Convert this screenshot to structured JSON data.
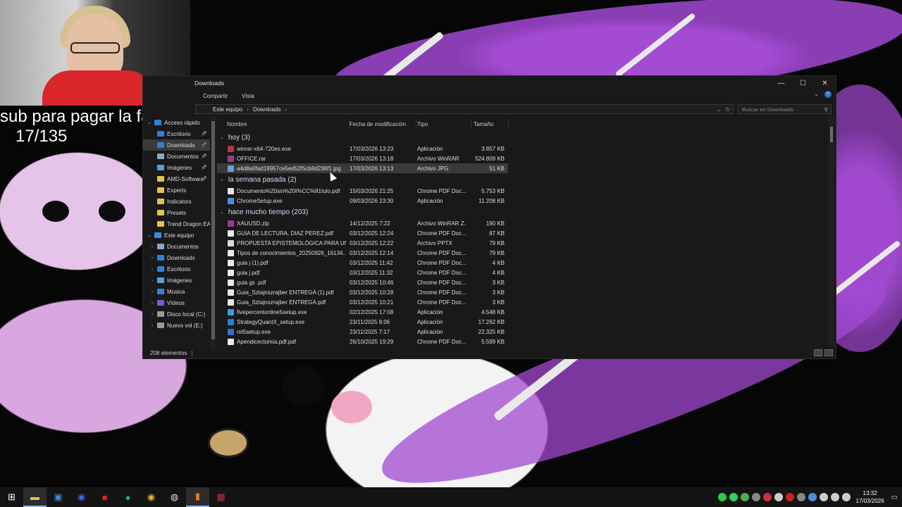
{
  "overlay": {
    "line1": "sub para pagar la facultad",
    "line2": "17/135"
  },
  "window": {
    "title": "Downloads",
    "controls": {
      "minimize": "—",
      "maximize": "☐",
      "close": "✕"
    },
    "ribbon": {
      "share": "Compartir",
      "view": "Vista"
    },
    "address": {
      "root": "Este equipo",
      "current": "Downloads",
      "sep": "›"
    },
    "search_placeholder": "Buscar en Downloads",
    "status": "208 elementos"
  },
  "nav": {
    "quick_access": "Acceso rápido",
    "quick_items": [
      {
        "label": "Escritorio",
        "color": "#2f7fd6"
      },
      {
        "label": "Downloads",
        "color": "#2f7fd6"
      },
      {
        "label": "Documentos",
        "color": "#8aa6c8"
      },
      {
        "label": "Imágenes",
        "color": "#5aa0d8"
      },
      {
        "label": "AMD-Software",
        "color": "#e6c24a"
      },
      {
        "label": "Experts",
        "color": "#e6c24a"
      },
      {
        "label": "Indicators",
        "color": "#e6c24a"
      },
      {
        "label": "Presets",
        "color": "#e6c24a"
      },
      {
        "label": "Trend Dragon EA",
        "color": "#e6c24a"
      }
    ],
    "this_pc": "Este equipo",
    "pc_items": [
      {
        "label": "Documentos",
        "color": "#8aa6c8"
      },
      {
        "label": "Downloads",
        "color": "#2f7fd6"
      },
      {
        "label": "Escritorio",
        "color": "#2f7fd6"
      },
      {
        "label": "Imágenes",
        "color": "#5aa0d8"
      },
      {
        "label": "Música",
        "color": "#3b7fe0"
      },
      {
        "label": "Vídeos",
        "color": "#7a5ad0"
      },
      {
        "label": "Disco local (C:)",
        "color": "#9a9a9a"
      },
      {
        "label": "Nuevo vol (E:)",
        "color": "#9a9a9a"
      }
    ]
  },
  "columns": {
    "name": "Nombre",
    "date": "Fecha de modificación",
    "type": "Tipo",
    "size": "Tamaño"
  },
  "groups": [
    {
      "label": "hoy (3)",
      "rows": [
        {
          "name": "winrar-x64-720es.exe",
          "date": "17/03/2026 13:23",
          "type": "Aplicación",
          "size": "3.857 KB",
          "color": "#b8324a"
        },
        {
          "name": "OFFICE.rar",
          "date": "17/03/2026 13:18",
          "type": "Archivo WinRAR",
          "size": "524.809 KB",
          "color": "#9b3a8e"
        },
        {
          "name": "a4d8a0fad19957ce5ed52f5cb8d236f1.jpg",
          "date": "17/03/2026 13:13",
          "type": "Archivo JPG",
          "size": "51 KB",
          "color": "#6aa0d8",
          "selected": true
        }
      ]
    },
    {
      "label": "la semana pasada (2)",
      "rows": [
        {
          "name": "Documento%20sin%20t%CC%81tulo.pdf",
          "date": "15/03/2026 21:25",
          "type": "Chrome PDF Doc...",
          "size": "5.753 KB",
          "color": "#e8e8e8"
        },
        {
          "name": "ChromeSetup.exe",
          "date": "09/03/2026 23:30",
          "type": "Aplicación",
          "size": "11.208 KB",
          "color": "#4a90e2"
        }
      ]
    },
    {
      "label": "hace mucho tiempo (203)",
      "rows": [
        {
          "name": "XAUUSD.zip",
          "date": "14/12/2025 7:22",
          "type": "Archivo WinRAR Z...",
          "size": "190 KB",
          "color": "#9b3a8e"
        },
        {
          "name": "GUIA DE LECTURA, DIAZ PEREZ.pdf",
          "date": "03/12/2025 12:24",
          "type": "Chrome PDF Doc...",
          "size": "87 KB",
          "color": "#e8e8e8"
        },
        {
          "name": "PROPUESTA EPISTEMOLÓGICA PARA UN...",
          "date": "03/12/2025 12:22",
          "type": "Archivo PPTX",
          "size": "79 KB",
          "color": "#d9d9d9"
        },
        {
          "name": "Tipos de conocimientos_20250926_16134...",
          "date": "03/12/2025 12:14",
          "type": "Chrome PDF Doc...",
          "size": "79 KB",
          "color": "#e8e8e8"
        },
        {
          "name": "guia j (1).pdf",
          "date": "03/12/2025 11:42",
          "type": "Chrome PDF Doc...",
          "size": "4 KB",
          "color": "#e8e8e8"
        },
        {
          "name": "guia j.pdf",
          "date": "03/12/2025 11:32",
          "type": "Chrome PDF Doc...",
          "size": "4 KB",
          "color": "#e8e8e8"
        },
        {
          "name": "guia gs .pdf",
          "date": "03/12/2025 10:46",
          "type": "Chrome PDF Doc...",
          "size": "3 KB",
          "color": "#e8e8e8"
        },
        {
          "name": "Guia_Sztajnszrajber ENTREGA (1).pdf",
          "date": "03/12/2025 10:28",
          "type": "Chrome PDF Doc...",
          "size": "3 KB",
          "color": "#e8e8e8"
        },
        {
          "name": "Guia_Sztajnszrajber ENTREGA.pdf",
          "date": "03/12/2025 10:21",
          "type": "Chrome PDF Doc...",
          "size": "3 KB",
          "color": "#e8e8e8"
        },
        {
          "name": "fivepercentonline5setup.exe",
          "date": "02/12/2025 17:08",
          "type": "Aplicación",
          "size": "4.548 KB",
          "color": "#3aa0d8"
        },
        {
          "name": "StrategyQuantX_setup.exe",
          "date": "23/11/2025 9:06",
          "type": "Aplicación",
          "size": "17.262 KB",
          "color": "#2a7fd4"
        },
        {
          "name": "mt5setup.exe",
          "date": "23/11/2025 7:17",
          "type": "Aplicación",
          "size": "22.325 KB",
          "color": "#3a6fc0"
        },
        {
          "name": "Apendicectomía.pdf.pdf",
          "date": "26/10/2025 19:29",
          "type": "Chrome PDF Doc...",
          "size": "5.599 KB",
          "color": "#e8e8e8"
        }
      ]
    }
  ],
  "taskbar": {
    "icons": [
      {
        "name": "windows-start-icon",
        "glyph": "⊞",
        "color": "#ffffff"
      },
      {
        "name": "file-explorer-icon",
        "glyph": "▬",
        "color": "#e6c24a",
        "active": true
      },
      {
        "name": "store-icon",
        "glyph": "▣",
        "color": "#3a8be0"
      },
      {
        "name": "chrome-profile-icon",
        "glyph": "◉",
        "color": "#3a6fe0"
      },
      {
        "name": "app-red-icon",
        "glyph": "■",
        "color": "#d02a2a"
      },
      {
        "name": "spotify-icon",
        "glyph": "●",
        "color": "#1db954"
      },
      {
        "name": "chrome-icon",
        "glyph": "◉",
        "color": "#e8b23a"
      },
      {
        "name": "obs-icon",
        "glyph": "◍",
        "color": "#dddddd"
      },
      {
        "name": "trading-app-icon",
        "glyph": "▮",
        "color": "#e07a2a",
        "active": true
      },
      {
        "name": "winrar-icon",
        "glyph": "▦",
        "color": "#c0304a"
      }
    ],
    "tray_colors": [
      "#2ecc40",
      "#25d366",
      "#4caf50",
      "#888888",
      "#d03040",
      "#cccccc",
      "#cc2020",
      "#888888",
      "#4a8fd8",
      "#cccccc",
      "#cccccc",
      "#cccccc"
    ],
    "time": "13:32",
    "date": "17/03/2026"
  }
}
